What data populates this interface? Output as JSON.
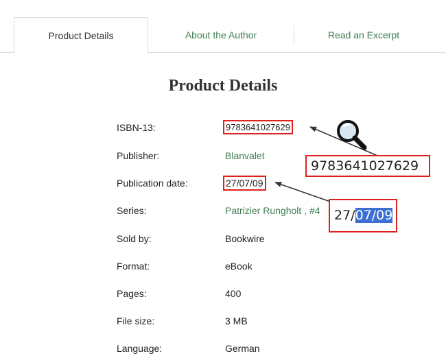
{
  "tabs": {
    "product_details": "Product Details",
    "about_author": "About the Author",
    "read_excerpt": "Read an Excerpt"
  },
  "heading": "Product Details",
  "details": [
    {
      "label": "ISBN-13:",
      "value": "9783641027629"
    },
    {
      "label": "Publisher:",
      "value": "Blanvalet"
    },
    {
      "label": "Publication date:",
      "value": "27/07/09"
    },
    {
      "label": "Series:",
      "value": "Patrizier Rungholt , #4"
    },
    {
      "label": "Sold by:",
      "value": "Bookwire"
    },
    {
      "label": "Format:",
      "value": "eBook"
    },
    {
      "label": "Pages:",
      "value": "400"
    },
    {
      "label": "File size:",
      "value": "3 MB"
    },
    {
      "label": "Language:",
      "value": "German"
    }
  ],
  "callouts": {
    "isbn_zoom": "9783641027629",
    "date_zoom_prefix": "27/",
    "date_zoom_selected": "07/09"
  },
  "colors": {
    "link_green": "#3f7d51",
    "highlight_red": "#e0201c",
    "selection_blue": "#3b6fd1"
  },
  "icons": {
    "zoom": "magnifier-icon"
  }
}
